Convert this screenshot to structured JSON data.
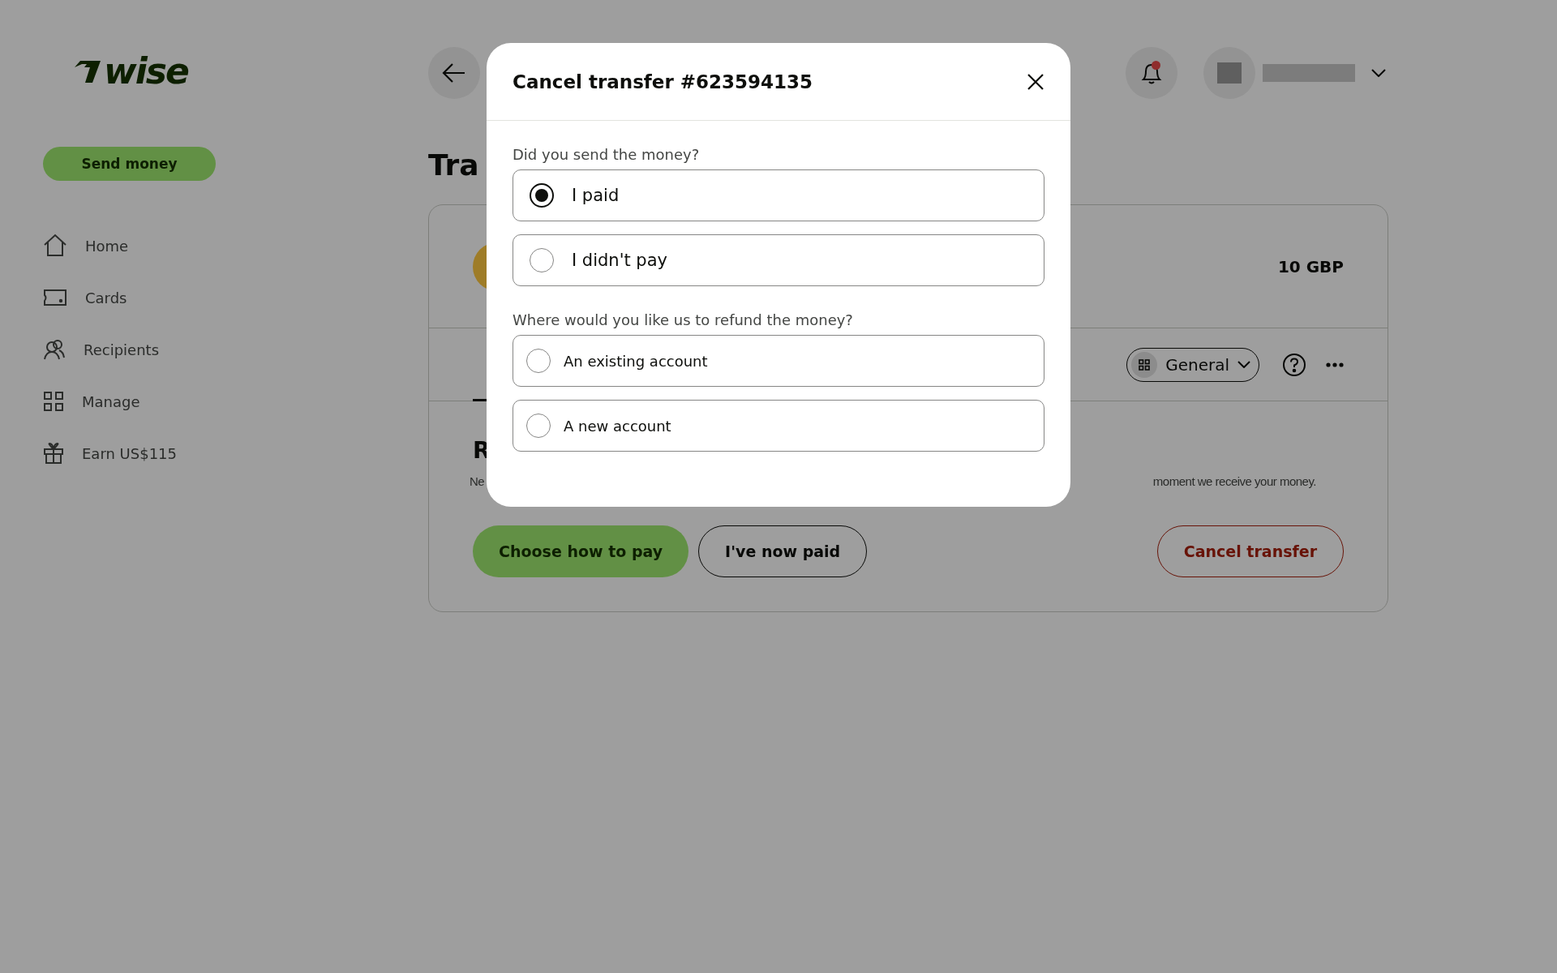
{
  "logo": {
    "text": "wise"
  },
  "sidebar": {
    "send_button": "Send money",
    "items": [
      {
        "label": "Home"
      },
      {
        "label": "Cards"
      },
      {
        "label": "Recipients"
      },
      {
        "label": "Manage"
      },
      {
        "label": "Earn US$115"
      }
    ]
  },
  "page": {
    "title": "Tra",
    "amount": "10 GBP",
    "view_dropdown": "General",
    "section_heading": "R",
    "description_start": "Ne",
    "description_end": "moment we receive your money.",
    "buttons": [
      {
        "label": "Choose how to pay",
        "kind": "primary"
      },
      {
        "label": "I've now paid",
        "kind": "secondary"
      },
      {
        "label": "Cancel transfer",
        "kind": "danger"
      }
    ]
  },
  "header": {
    "notification_dot": true
  },
  "modal": {
    "title": "Cancel transfer #623594135",
    "questions": [
      {
        "label": "Did you send the money?",
        "options": [
          {
            "label": "I paid",
            "selected": true
          },
          {
            "label": "I didn't pay",
            "selected": false
          }
        ]
      },
      {
        "label": "Where would you like us to refund the money?",
        "options": [
          {
            "label": "An existing account",
            "selected": false
          },
          {
            "label": "A new account",
            "selected": false
          }
        ]
      }
    ]
  }
}
